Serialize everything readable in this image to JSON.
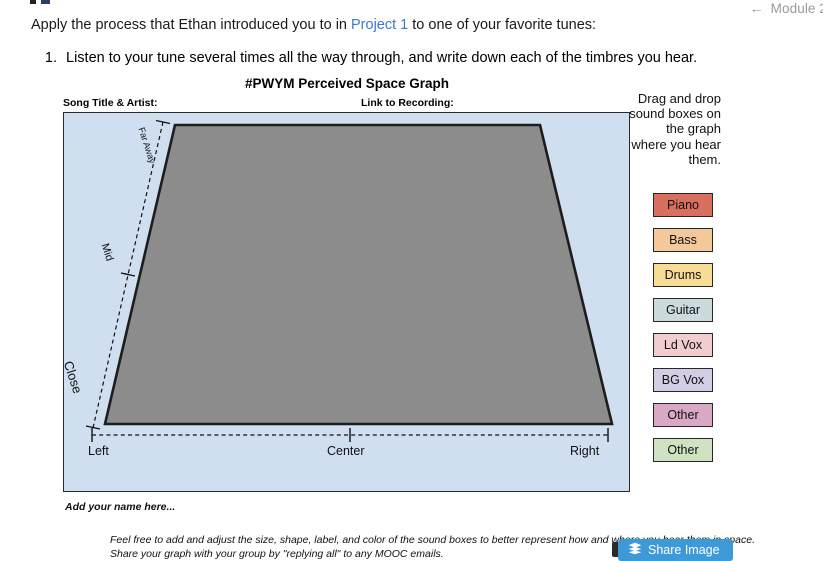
{
  "nav": {
    "back_label": "Module 2",
    "back_icon": "arrow-left-icon"
  },
  "content": {
    "intro_before": "Apply the process that Ethan introduced you to in ",
    "intro_link": "Project 1",
    "intro_after": " to one of your favorite tunes:",
    "steps": [
      {
        "number": "1.",
        "text": "Listen to your tune several times all the way through, and write down each of the timbres you hear."
      }
    ]
  },
  "graph": {
    "title": "#PWYM Perceived Space Graph",
    "song_label": "Song Title & Artist:",
    "link_label": "Link to Recording:",
    "song_value": "",
    "link_value": "",
    "panel_color": "#cfdff0",
    "shape_color": "#8c8c8c",
    "x_axis": {
      "left": "Left",
      "center": "Center",
      "right": "Right"
    },
    "depth_axis": {
      "far": "Far Away",
      "mid": "Mid",
      "close": "Close"
    },
    "name_placeholder": "Add your name here...",
    "footer_note": "Feel free to add and adjust the size, shape, label, and color of the sound boxes to better represent how and where you hear them in space. Share your graph with your group by \"replying all\" to any MOOC emails."
  },
  "sidebar": {
    "instruction": "Drag and drop sound boxes on the graph where you hear them.",
    "boxes": [
      {
        "label": "Piano",
        "color": "#d9705f"
      },
      {
        "label": "Bass",
        "color": "#f5c89b"
      },
      {
        "label": "Drums",
        "color": "#f7dd94"
      },
      {
        "label": "Guitar",
        "color": "#ccdade"
      },
      {
        "label": "Ld Vox",
        "color": "#f2cdcd"
      },
      {
        "label": "BG Vox",
        "color": "#d3cde6"
      },
      {
        "label": "Other",
        "color": "#d9a8c4"
      },
      {
        "label": "Other",
        "color": "#cfe3c2"
      }
    ]
  },
  "share": {
    "label": "Share Image",
    "icon": "layers-stack-icon",
    "color": "#3d9ad6"
  }
}
